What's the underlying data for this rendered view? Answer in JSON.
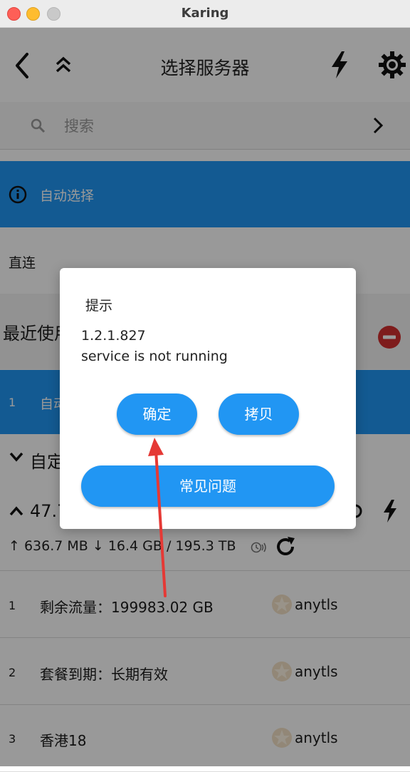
{
  "window": {
    "title": "Karing"
  },
  "header": {
    "title": "选择服务器"
  },
  "search": {
    "placeholder": "搜索"
  },
  "auto_select": {
    "label": "自动选择"
  },
  "direct": {
    "label": "直连"
  },
  "recent": {
    "label": "最近使用",
    "items": [
      {
        "num": "1",
        "text": "自动选择"
      }
    ]
  },
  "custom_group": {
    "label": "自定义"
  },
  "subscription_group": {
    "label": "47.7",
    "traffic": "↑ 636.7 MB ↓ 16.4 GB / 195.3 TB"
  },
  "servers": [
    {
      "num": "1",
      "name": "剩余流量：199983.02 GB",
      "type": "anytls"
    },
    {
      "num": "2",
      "name": "套餐到期：长期有效",
      "type": "anytls"
    },
    {
      "num": "3",
      "name": "香港18",
      "type": "anytls"
    }
  ],
  "dialog": {
    "title": "提示",
    "version": "1.2.1.827",
    "message": "service is not running",
    "ok_label": "确定",
    "copy_label": "拷贝",
    "faq_label": "常见问题"
  },
  "colors": {
    "accent": "#2196f3",
    "danger": "#d32f2f",
    "arrow": "#e53935"
  },
  "icons": [
    "back-icon",
    "collapse-icon",
    "flash-icon",
    "gear-icon",
    "search-icon",
    "chevron-right-icon",
    "info-icon",
    "remove-icon",
    "chevron-down-icon",
    "chevron-up-icon",
    "speed-icon",
    "clock-icon",
    "refresh-icon",
    "star-icon"
  ]
}
